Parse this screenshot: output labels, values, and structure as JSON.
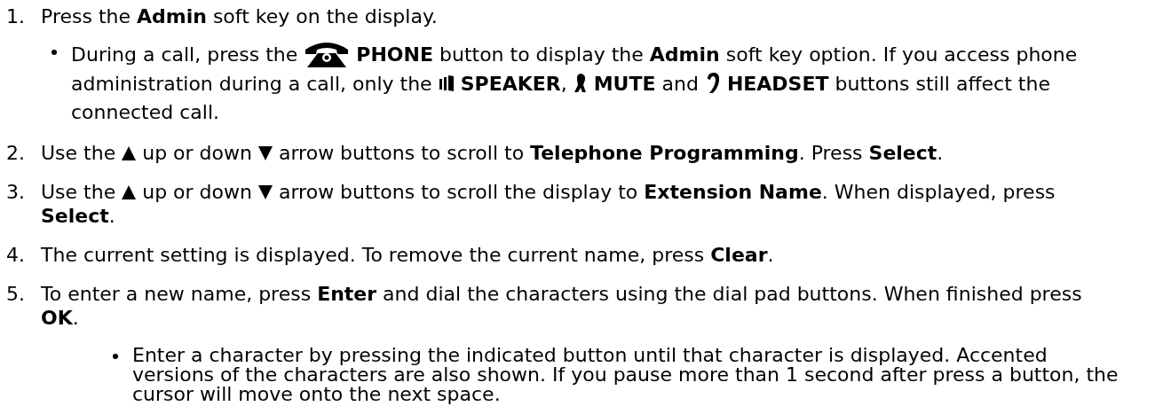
{
  "steps": [
    {
      "number": "1.",
      "lines": [
        [
          {
            "kind": "text",
            "text": "Press the **Admin** soft key on the display."
          }
        ]
      ],
      "notes": [
        {
          "lines": [
            [
              {
                "kind": "text",
                "text": "During a call, press the"
              },
              {
                "kind": "handset"
              },
              {
                "kind": "text",
                "text": "**PHONE** button to display the **Admin** soft key option. If you access phone"
              }
            ],
            [
              {
                "kind": "text",
                "text": "administration during a call, only the"
              },
              {
                "kind": "speaker"
              },
              {
                "kind": "text",
                "text": "**SPEAKER**,"
              },
              {
                "kind": "microphone"
              },
              {
                "kind": "text",
                "text": "**MUTE** and"
              },
              {
                "kind": "headset"
              },
              {
                "kind": "text",
                "text": "**HEADSET** buttons still affect the"
              }
            ],
            [
              {
                "kind": "text",
                "text": "connected call."
              }
            ]
          ]
        }
      ]
    },
    {
      "number": "2.",
      "lines": [
        [
          {
            "kind": "text",
            "text": "Use the"
          },
          {
            "kind": "up"
          },
          {
            "kind": "text",
            "text": "up or down"
          },
          {
            "kind": "down"
          },
          {
            "kind": "text",
            "text": "arrow buttons to scroll to **Telephone Programming**. Press **Select**."
          }
        ]
      ]
    },
    {
      "number": "3.",
      "lines": [
        [
          {
            "kind": "text",
            "text": "Use the"
          },
          {
            "kind": "up"
          },
          {
            "kind": "text",
            "text": "up or down"
          },
          {
            "kind": "down"
          },
          {
            "kind": "text",
            "text": "arrow buttons to scroll the display to **Extension Name**. When displayed, press"
          }
        ],
        [
          {
            "kind": "text",
            "text": "**Select**."
          }
        ]
      ]
    },
    {
      "number": "4.",
      "lines": [
        [
          {
            "kind": "text",
            "text": "The current setting is displayed. To remove the current name, press **Clear**."
          }
        ]
      ]
    },
    {
      "number": "5.",
      "lines": [
        [
          {
            "kind": "text",
            "text": "To enter a new name, press **Enter** and dial the characters using the dial pad buttons. When finished press"
          }
        ],
        [
          {
            "kind": "text",
            "text": "**OK**."
          }
        ]
      ],
      "notes": [
        {
          "lines": [
            [
              {
                "kind": "text",
                "text": "Enter a character by pressing the indicated button until that character is displayed. Accented"
              }
            ],
            [
              {
                "kind": "text",
                "text": "versions of the characters are also shown. If you pause more than 1 second after press a button, the"
              }
            ],
            [
              {
                "kind": "text",
                "text": "cursor will move onto the next space."
              }
            ]
          ]
        }
      ]
    }
  ]
}
